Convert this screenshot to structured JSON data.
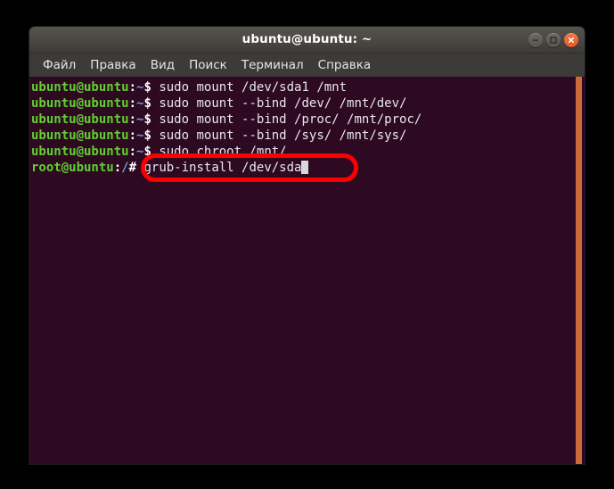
{
  "window": {
    "title": "ubuntu@ubuntu: ~",
    "controls": [
      {
        "name": "minimize",
        "glyph": "minus"
      },
      {
        "name": "maximize",
        "glyph": "square"
      },
      {
        "name": "close",
        "glyph": "cross"
      }
    ]
  },
  "menu": {
    "items": [
      {
        "label": "Файл"
      },
      {
        "label": "Правка"
      },
      {
        "label": "Вид"
      },
      {
        "label": "Поиск"
      },
      {
        "label": "Терминал"
      },
      {
        "label": "Справка"
      }
    ]
  },
  "terminal": {
    "background_color": "#2d0922",
    "prompt_color": "#60d030",
    "path_color": "#6f9ddb",
    "text_color": "#e5e5e5",
    "scrollbar_color": "#cd6a3c",
    "lines": [
      {
        "user": "ubuntu@ubuntu",
        "colon": ":",
        "path": "~",
        "sigil": "$",
        "command": " sudo mount /dev/sda1 /mnt",
        "cursor": false
      },
      {
        "user": "ubuntu@ubuntu",
        "colon": ":",
        "path": "~",
        "sigil": "$",
        "command": " sudo mount --bind /dev/ /mnt/dev/",
        "cursor": false
      },
      {
        "user": "ubuntu@ubuntu",
        "colon": ":",
        "path": "~",
        "sigil": "$",
        "command": " sudo mount --bind /proc/ /mnt/proc/",
        "cursor": false
      },
      {
        "user": "ubuntu@ubuntu",
        "colon": ":",
        "path": "~",
        "sigil": "$",
        "command": " sudo mount --bind /sys/ /mnt/sys/",
        "cursor": false
      },
      {
        "user": "ubuntu@ubuntu",
        "colon": ":",
        "path": "~",
        "sigil": "$",
        "command": " sudo chroot /mnt/",
        "cursor": false
      },
      {
        "user": "root@ubuntu",
        "colon": ":",
        "path": "/",
        "sigil": "#",
        "command": " grub-install /dev/sda",
        "cursor": true
      }
    ]
  },
  "annotation": {
    "shape": "ellipse",
    "color": "#fb0000",
    "highlights": "grub-install /dev/sda"
  }
}
